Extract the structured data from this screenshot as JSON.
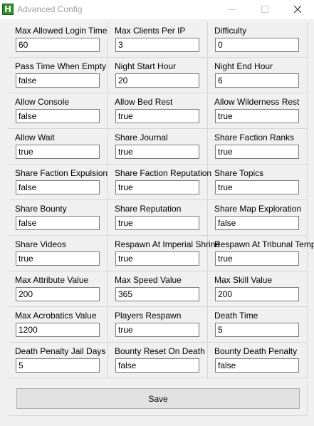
{
  "window": {
    "title": "Advanced Config",
    "icon": "H"
  },
  "settings": [
    {
      "label": "Max Allowed Login Time",
      "value": "60"
    },
    {
      "label": "Max Clients Per IP",
      "value": "3"
    },
    {
      "label": "Difficulty",
      "value": "0"
    },
    {
      "label": "Pass Time When Empty",
      "value": "false"
    },
    {
      "label": "Night Start Hour",
      "value": "20"
    },
    {
      "label": "Night End Hour",
      "value": "6"
    },
    {
      "label": "Allow Console",
      "value": "false"
    },
    {
      "label": "Allow Bed Rest",
      "value": "true"
    },
    {
      "label": "Allow Wilderness Rest",
      "value": "true"
    },
    {
      "label": "Allow Wait",
      "value": "true"
    },
    {
      "label": "Share Journal",
      "value": "true"
    },
    {
      "label": "Share Faction Ranks",
      "value": "true"
    },
    {
      "label": "Share Faction Expulsion",
      "value": "false"
    },
    {
      "label": "Share Faction Reputation",
      "value": "true"
    },
    {
      "label": "Share Topics",
      "value": "true"
    },
    {
      "label": "Share Bounty",
      "value": "false"
    },
    {
      "label": "Share Reputation",
      "value": "true"
    },
    {
      "label": "Share Map Exploration",
      "value": "false"
    },
    {
      "label": "Share Videos",
      "value": "true"
    },
    {
      "label": "Respawn At Imperial Shrine",
      "value": "true"
    },
    {
      "label": "Respawn At Tribunal Temple",
      "value": "true"
    },
    {
      "label": "Max Attribute Value",
      "value": "200"
    },
    {
      "label": "Max Speed Value",
      "value": "365"
    },
    {
      "label": "Max Skill Value",
      "value": "200"
    },
    {
      "label": "Max Acrobatics Value",
      "value": "1200"
    },
    {
      "label": "Players Respawn",
      "value": "true"
    },
    {
      "label": "Death Time",
      "value": "5"
    },
    {
      "label": "Death Penalty Jail Days",
      "value": "5"
    },
    {
      "label": "Bounty Reset On Death",
      "value": "false"
    },
    {
      "label": "Bounty Death Penalty",
      "value": "false"
    }
  ],
  "footer": {
    "save_label": "Save"
  },
  "colors": {
    "app_icon": "#2f8f2f",
    "background": "#f0f0f0",
    "button": "#e1e1e1"
  }
}
